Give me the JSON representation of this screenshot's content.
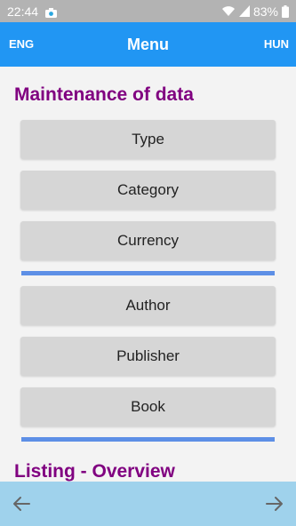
{
  "status_bar": {
    "time": "22:44",
    "battery": "83%",
    "icons": [
      "camera-icon",
      "wifi-icon",
      "signal-icon",
      "battery-icon"
    ]
  },
  "app_bar": {
    "title": "Menu",
    "left_lang": "ENG",
    "right_lang": "HUN",
    "color": "#2196f3"
  },
  "sections": {
    "maintenance": {
      "title": "Maintenance of data",
      "buttons": [
        "Type",
        "Category",
        "Currency",
        "Author",
        "Publisher",
        "Book"
      ]
    },
    "listing": {
      "title": "Listing - Overview"
    }
  },
  "bottom_bar": {
    "back_icon": "arrow-left-icon",
    "forward_icon": "arrow-right-icon"
  },
  "colors": {
    "section_title": "#800080",
    "divider": "#5d8fe6",
    "bottom_bar": "#9fd2ec"
  }
}
